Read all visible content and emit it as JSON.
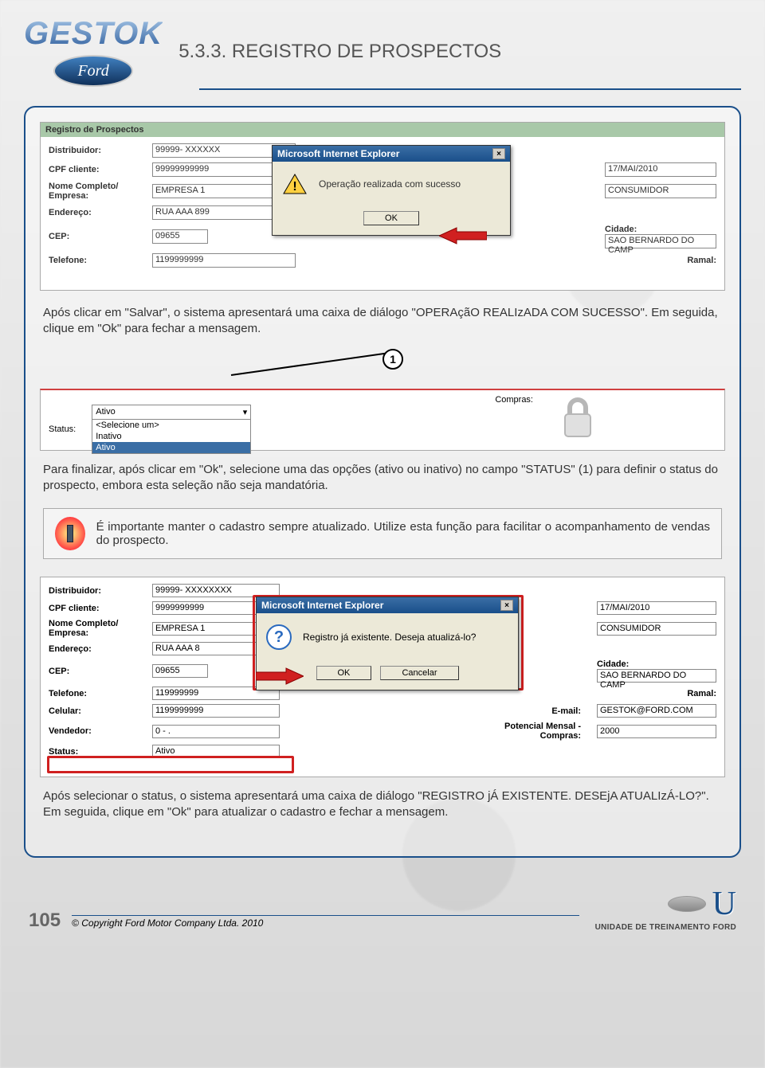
{
  "header": {
    "logo_text": "GESTOK",
    "ford_text": "Ford",
    "title": "5.3.3. REGISTRO DE PROSPECTOS"
  },
  "screenshot1": {
    "section_title": "Registro de Prospectos",
    "labels": {
      "distribuidor": "Distribuidor:",
      "cpf": "CPF cliente:",
      "nome": "Nome Completo/\nEmpresa:",
      "endereco": "Endereço:",
      "cep": "CEP:",
      "telefone": "Telefone:",
      "cidade": "Cidade:",
      "ramal": "Ramal:"
    },
    "values": {
      "distribuidor": "99999- XXXXXX",
      "cpf": "99999999999",
      "nome": "EMPRESA 1",
      "endereco": "RUA AAA  899",
      "cep": "09655",
      "telefone": "1199999999",
      "data": "17/MAI/2010",
      "tipo": "CONSUMIDOR",
      "cidade": "SAO BERNARDO DO CAMP"
    },
    "dialog": {
      "title": "Microsoft Internet Explorer",
      "message": "Operação realizada com sucesso",
      "ok": "OK"
    }
  },
  "para1": "Após clicar em \"Salvar\", o sistema apresentará uma caixa de diálogo \"OPERAçãO REALIzADA COM SUCESSO\". Em seguida, clique em \"Ok\" para fechar a mensagem.",
  "callout1": "1",
  "status_shot": {
    "status_label": "Status:",
    "compras_label": "Compras:",
    "selected": "Ativo",
    "options": [
      "<Selecione um>",
      "Inativo",
      "Ativo"
    ]
  },
  "para2": "Para finalizar, após clicar em \"Ok\", selecione uma das opções (ativo ou inativo) no campo \"STATUS\" (1) para definir o status do prospecto, embora esta seleção não seja mandatória.",
  "info_box": "É importante manter o cadastro sempre atualizado. Utilize esta função para facilitar o acompanhamento de vendas do prospecto.",
  "screenshot2": {
    "labels": {
      "distribuidor": "Distribuidor:",
      "cpf": "CPF cliente:",
      "nome": "Nome Completo/\nEmpresa:",
      "endereco": "Endereço:",
      "cep": "CEP:",
      "telefone": "Telefone:",
      "celular": "Celular:",
      "vendedor": "Vendedor:",
      "status": "Status:",
      "email": "E-mail:",
      "potencial": "Potencial Mensal -\nCompras:",
      "cidade": "Cidade:",
      "ramal": "Ramal:"
    },
    "values": {
      "distribuidor": "99999- XXXXXXXX",
      "cpf": "9999999999",
      "nome": "EMPRESA 1",
      "endereco": "RUA AAA  8",
      "cep": "09655",
      "telefone": "119999999",
      "celular": "1199999999",
      "vendedor": "0 - .",
      "status": "Ativo",
      "data": "17/MAI/2010",
      "tipo": "CONSUMIDOR",
      "cidade": "SAO BERNARDO DO CAMP",
      "email": "GESTOK@FORD.COM",
      "potencial": "2000"
    },
    "dialog": {
      "title": "Microsoft Internet Explorer",
      "message": "Registro já existente. Deseja atualizá-lo?",
      "ok": "OK",
      "cancel": "Cancelar"
    }
  },
  "para3": "Após selecionar o status, o sistema apresentará uma caixa de diálogo \"REGISTRO jÁ EXISTENTE. DESEjA ATUALIzÁ-LO?\". Em seguida, clique em \"Ok\" para atualizar o cadastro e fechar a mensagem.",
  "footer": {
    "page": "105",
    "copyright": "© Copyright Ford Motor Company Ltda. 2010",
    "unit": "UNIDADE DE TREINAMENTO FORD"
  }
}
